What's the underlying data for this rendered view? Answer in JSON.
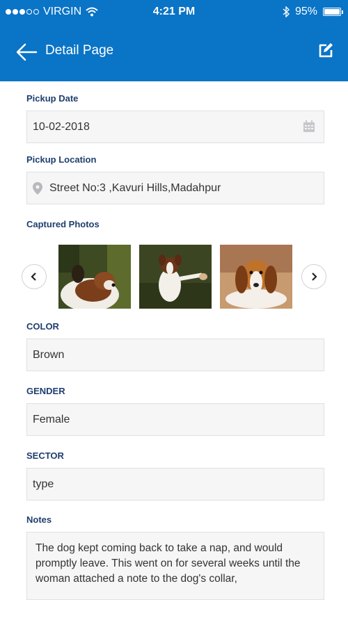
{
  "status_bar": {
    "carrier": "VIRGIN",
    "time": "4:21 PM",
    "battery": "95%"
  },
  "header": {
    "title": "Detail Page",
    "back_icon": "arrow-left-icon",
    "edit_icon": "edit-icon"
  },
  "form": {
    "pickup_date": {
      "label": "Pickup Date",
      "value": "10-02-2018"
    },
    "pickup_location": {
      "label": "Pickup Location",
      "value": "Street No:3 ,Kavuri Hills,Madahpur"
    },
    "captured_photos": {
      "label": "Captured Photos",
      "photos": [
        "st-bernard-dog",
        "border-collie-dog",
        "beagle-dog"
      ]
    },
    "color": {
      "label": "COLOR",
      "value": "Brown"
    },
    "gender": {
      "label": "GENDER",
      "value": "Female"
    },
    "sector": {
      "label": "SECTOR",
      "value": "type"
    },
    "notes": {
      "label": "Notes",
      "value": "The dog kept coming back to take a nap, and would promptly leave. This went on for several weeks until the woman attached a note to the dog's collar,"
    }
  },
  "colors": {
    "primary": "#0a74c6",
    "label": "#1f3e6e",
    "field_bg": "#f6f6f7"
  }
}
